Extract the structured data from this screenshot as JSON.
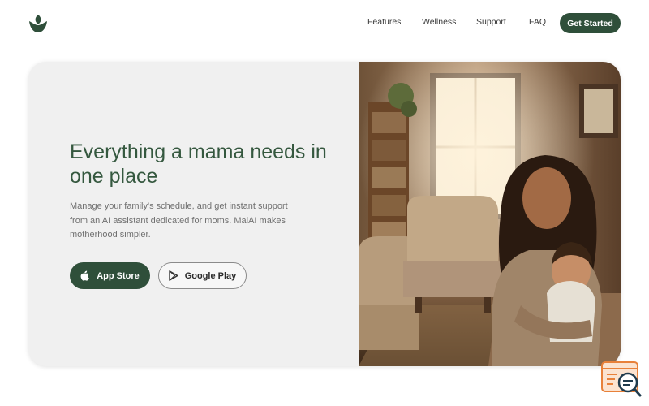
{
  "nav": {
    "links": [
      "Features",
      "Wellness",
      "Support",
      "FAQ"
    ],
    "cta_label": "Get Started",
    "logo_icon": "sprout-leaf-icon"
  },
  "hero": {
    "headline": "Everything a mama needs in one place",
    "subtext": "Manage your family's schedule, and get instant support from an AI assistant dedicated for moms. MaiAI makes motherhood simpler.",
    "app_store_label": "App Store",
    "google_play_label": "Google Play",
    "app_store_icon": "apple-icon",
    "google_play_icon": "play-store-icon",
    "photo_description": "mother-holding-baby-in-living-room-photo"
  },
  "chat_widget": {
    "icon": "chat-search-icon"
  },
  "colors": {
    "brand": "#2f4f3a",
    "headline": "#35583f",
    "hero_bg": "#f0f0f0",
    "widget": "#e8813a"
  }
}
